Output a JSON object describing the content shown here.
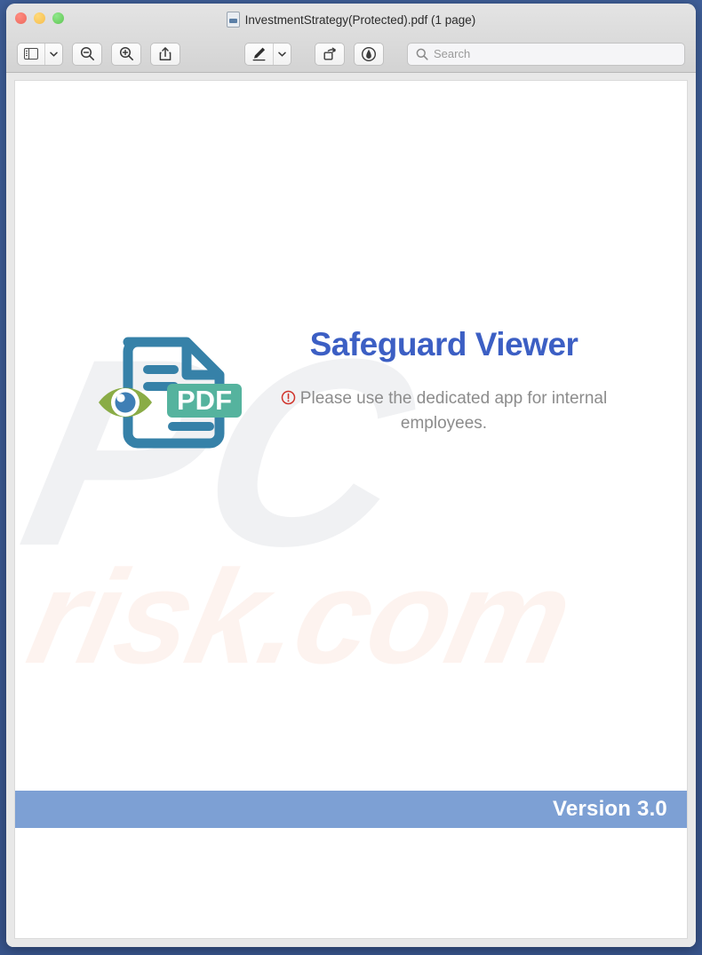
{
  "window": {
    "title": "InvestmentStrategy(Protected).pdf (1 page)",
    "traffic_lights": [
      {
        "name": "close",
        "color": "#ec6a5e"
      },
      {
        "name": "minimize",
        "color": "#f5bd4f"
      },
      {
        "name": "zoom",
        "color": "#61c554"
      }
    ]
  },
  "toolbar": {
    "sidebar_icon": "sidebar-icon",
    "sidebar_chevron_icon": "chevron-down-icon",
    "zoom_out_icon": "zoom-out-icon",
    "zoom_in_icon": "zoom-in-icon",
    "share_icon": "share-icon",
    "markup_icon": "markup-pen-icon",
    "markup_chevron_icon": "chevron-down-icon",
    "rotate_icon": "rotate-icon",
    "annotate_icon": "annotate-icon",
    "search_icon": "search-icon",
    "search_placeholder": "Search",
    "search_value": ""
  },
  "document": {
    "watermarks": {
      "primary": "PC",
      "secondary": "risk.com"
    },
    "brand": {
      "icon_name": "pdf-viewer-eye-icon",
      "badge_label": "PDF",
      "colors": {
        "document_outline": "#3681a8",
        "eye_lens": "#8aac46",
        "eye_pupil": "#3f7fb5",
        "pdf_badge": "#55b39e"
      }
    },
    "title": "Safeguard Viewer",
    "notice": {
      "icon_name": "alert-circle-icon",
      "icon_color": "#d0342c",
      "text": "Please use the dedicated app for internal employees."
    },
    "version_banner": {
      "label": "Version 3.0",
      "color": "#7da0d4"
    }
  }
}
